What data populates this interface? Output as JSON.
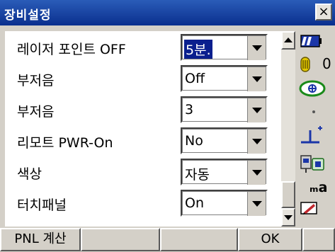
{
  "window": {
    "title": "장비설정",
    "close_label": "×"
  },
  "settings": [
    {
      "label": "레이저 포인트 OFF",
      "value": "5분."
    },
    {
      "label": "부저음",
      "value": "Off"
    },
    {
      "label": "부저음",
      "value": "3"
    },
    {
      "label": "리모트 PWR-On",
      "value": "No"
    },
    {
      "label": "색상",
      "value": "자동"
    },
    {
      "label": "터치패널",
      "value": "On"
    }
  ],
  "status": {
    "battery_icon": "battery-icon",
    "counter_value": "0",
    "unit_text": "ₘa"
  },
  "softkeys": [
    "PNL 계산",
    "",
    "",
    "OK",
    ""
  ],
  "colors": {
    "titlebar": "#0a2f8e",
    "selection": "#0a1f8e",
    "face": "#d4d0c8"
  }
}
